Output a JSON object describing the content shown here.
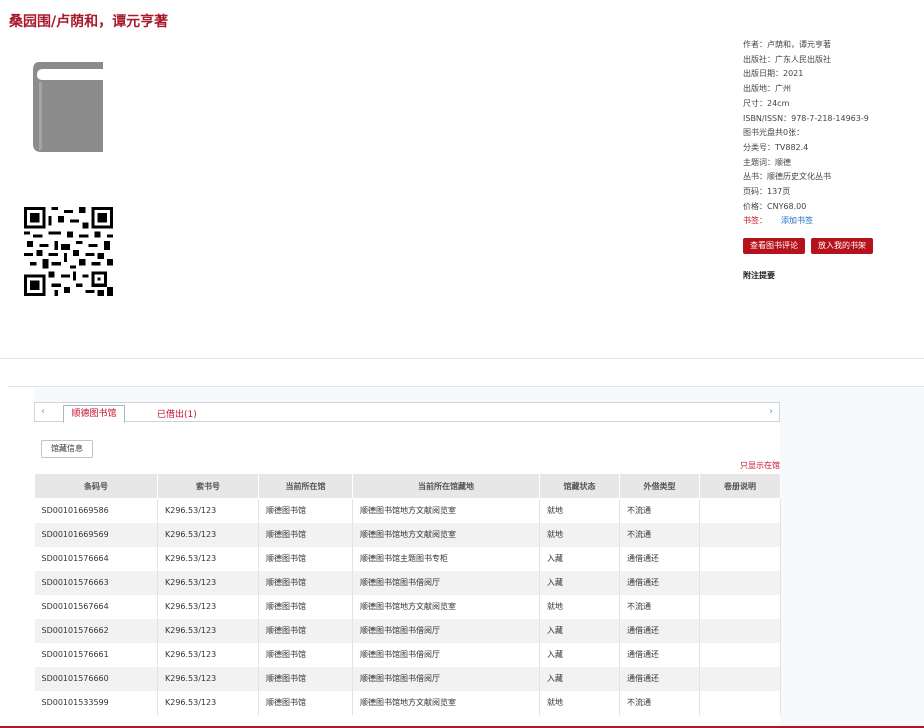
{
  "title": "桑园围/卢荫和，谭元亨著",
  "icons": {
    "cover": "book-icon",
    "qr": "qr-code-icon"
  },
  "meta": [
    {
      "text": "作者：卢荫和，谭元亨著"
    },
    {
      "text": "出版社：广东人民出版社"
    },
    {
      "text": "出版日期：2021"
    },
    {
      "text": "出版地：广州"
    },
    {
      "text": "尺寸：24cm"
    },
    {
      "text": "ISBN/ISSN：978-7-218-14963-9"
    },
    {
      "text": "图书光盘共0张："
    },
    {
      "text": "分类号：TV882.4"
    },
    {
      "text": "主题词：顺德"
    },
    {
      "text": "丛书：顺德历史文化丛书"
    },
    {
      "text": "页码：137页"
    },
    {
      "text": "价格：CNY68.00"
    }
  ],
  "bookmark": {
    "label": "书签：",
    "link": "添加书签"
  },
  "buttons": {
    "review": "查看图书评论",
    "shelf": "放入我的书架"
  },
  "attach_label": "附注提要",
  "tabs": {
    "prev": "‹",
    "next": "›",
    "active": "顺德图书馆",
    "second": "已借出(1)"
  },
  "subtab": "馆藏信息",
  "only_show": "只显示在馆",
  "colors": {
    "brand": "#a8192e",
    "button": "#b5121b",
    "link": "#1a6fbf"
  },
  "table": {
    "headers": [
      "条码号",
      "索书号",
      "当前所在馆",
      "当前所在馆藏地",
      "馆藏状态",
      "外借类型",
      "卷册说明"
    ],
    "rows": [
      [
        "SD00101669586",
        "K296.53/123",
        "顺德图书馆",
        "顺德图书馆地方文献阅览室",
        "就地",
        "不流通",
        ""
      ],
      [
        "SD00101669569",
        "K296.53/123",
        "顺德图书馆",
        "顺德图书馆地方文献阅览室",
        "就地",
        "不流通",
        ""
      ],
      [
        "SD00101576664",
        "K296.53/123",
        "顺德图书馆",
        "顺德图书馆主题图书专柜",
        "入藏",
        "通借通还",
        ""
      ],
      [
        "SD00101576663",
        "K296.53/123",
        "顺德图书馆",
        "顺德图书馆图书借阅厅",
        "入藏",
        "通借通还",
        ""
      ],
      [
        "SD00101567664",
        "K296.53/123",
        "顺德图书馆",
        "顺德图书馆地方文献阅览室",
        "就地",
        "不流通",
        ""
      ],
      [
        "SD00101576662",
        "K296.53/123",
        "顺德图书馆",
        "顺德图书馆图书借阅厅",
        "入藏",
        "通借通还",
        ""
      ],
      [
        "SD00101576661",
        "K296.53/123",
        "顺德图书馆",
        "顺德图书馆图书借阅厅",
        "入藏",
        "通借通还",
        ""
      ],
      [
        "SD00101576660",
        "K296.53/123",
        "顺德图书馆",
        "顺德图书馆图书借阅厅",
        "入藏",
        "通借通还",
        ""
      ],
      [
        "SD00101533599",
        "K296.53/123",
        "顺德图书馆",
        "顺德图书馆地方文献阅览室",
        "就地",
        "不流通",
        ""
      ]
    ]
  }
}
